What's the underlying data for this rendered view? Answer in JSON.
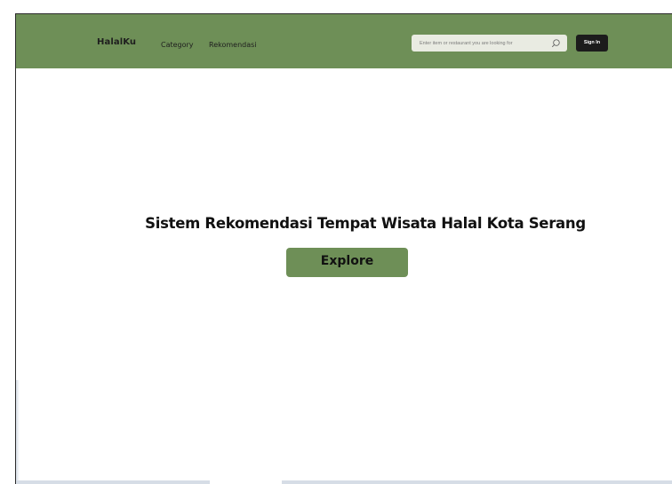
{
  "navbar": {
    "brand": "HalalKu",
    "links": [
      {
        "label": "Category"
      },
      {
        "label": "Rekomendasi"
      }
    ],
    "search": {
      "placeholder": "Enter item or restaurant you are looking for",
      "value": "",
      "icon": "search-icon"
    },
    "signin_label": "Sign In"
  },
  "hero": {
    "title": "Sistem Rekomendasi Tempat Wisata Halal Kota Serang",
    "button_label": "Explore"
  },
  "colors": {
    "nav_background": "#6e8f57",
    "button_background": "#6e8f57",
    "signin_background": "#1c1c1c",
    "search_background": "#e9ebe2"
  }
}
